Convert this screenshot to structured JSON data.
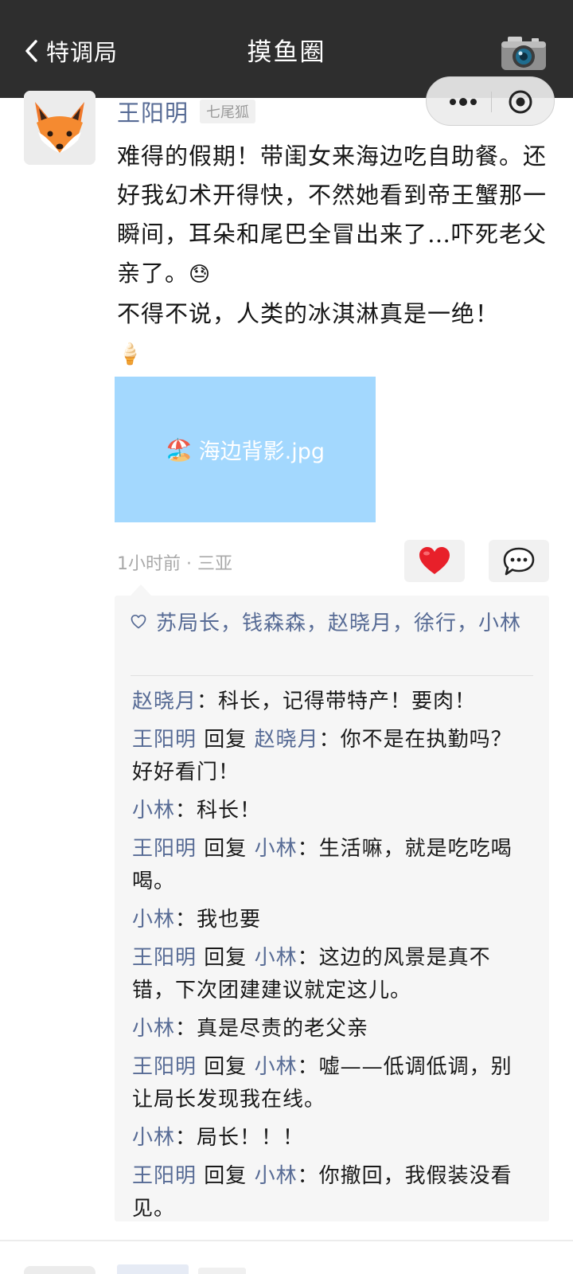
{
  "nav": {
    "back_label": "特调局",
    "title": "摸鱼圈"
  },
  "post": {
    "author": "王阳明",
    "author_tag": "七尾狐",
    "avatar": "fox-emoji",
    "lines": [
      "难得的假期！带闺女来海边吃自助餐。还好我幻术开得快，不然她看到帝王蟹那一瞬间，耳朵和尾巴全冒出来了…吓死老父亲了。",
      "不得不说，人类的冰淇淋真是一绝！"
    ],
    "emoji_1": "😓",
    "emoji_2": "🍦",
    "image_label": "海边背影.jpg",
    "image_icon": "🏖️",
    "time": "1小时前",
    "location": "三亚",
    "meta_sep": " · ",
    "like_icon": "❤️",
    "comment_icon": "💬"
  },
  "likes": {
    "names": "苏局长，钱森森，赵晓月，徐行，小林"
  },
  "reply_word": "回复",
  "comments": [
    {
      "author": "赵晓月",
      "reply_to": "",
      "text": "科长，记得带特产！要肉！"
    },
    {
      "author": "王阳明",
      "reply_to": "赵晓月",
      "text": "你不是在执勤吗？好好看门！"
    },
    {
      "author": "小林",
      "reply_to": "",
      "text": "科长！"
    },
    {
      "author": "王阳明",
      "reply_to": "小林",
      "text": "生活嘛，就是吃吃喝喝。"
    },
    {
      "author": "小林",
      "reply_to": "",
      "text": "我也要"
    },
    {
      "author": "王阳明",
      "reply_to": "小林",
      "text": "这边的风景是真不错，下次团建建议就定这儿。"
    },
    {
      "author": "小林",
      "reply_to": "",
      "text": "真是尽责的老父亲"
    },
    {
      "author": "王阳明",
      "reply_to": "小林",
      "text": "嘘——低调低调，别让局长发现我在线。"
    },
    {
      "author": "小林",
      "reply_to": "",
      "text": "局长！！！"
    },
    {
      "author": "王阳明",
      "reply_to": "小林",
      "text": "你撤回，我假装没看见。"
    }
  ],
  "colors": {
    "nav_bg": "#2e2e2e",
    "name_blue": "#576b95",
    "photo_bg": "#a3d8fe",
    "comment_bg": "#f6f6f6"
  }
}
